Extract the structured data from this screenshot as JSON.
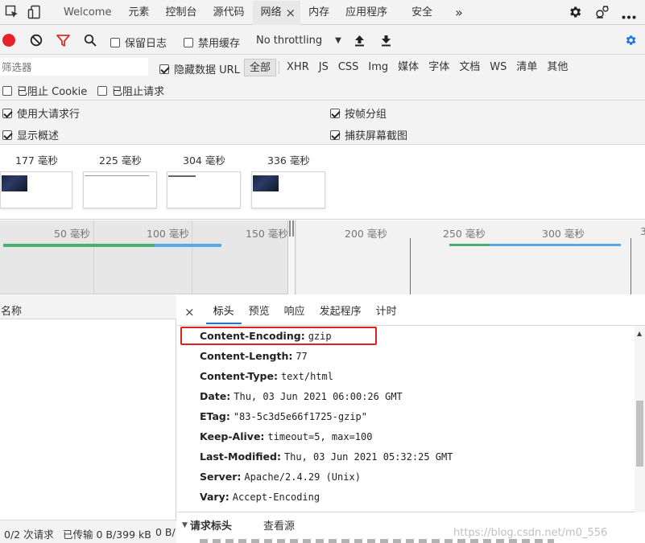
{
  "top_tabs": {
    "items": [
      {
        "label": "Welcome"
      },
      {
        "label": "元素"
      },
      {
        "label": "控制台"
      },
      {
        "label": "源代码"
      },
      {
        "label": "网络",
        "active": true
      },
      {
        "label": "内存"
      },
      {
        "label": "应用程序"
      },
      {
        "label": "安全"
      }
    ],
    "close_glyph": "×",
    "more_glyph": "»"
  },
  "toolbar": {
    "preserve_log": "保留日志",
    "disable_cache": "禁用缓存",
    "throttling": "No throttling"
  },
  "filter_bar": {
    "placeholder": "筛选器",
    "hide_data_urls": "隐藏数据 URL",
    "types": [
      "全部",
      "XHR",
      "JS",
      "CSS",
      "Img",
      "媒体",
      "字体",
      "文档",
      "WS",
      "清单",
      "其他"
    ]
  },
  "block_row": {
    "blocked_cookies": "已阻止 Cookie",
    "blocked_requests": "已阻止请求"
  },
  "options": {
    "large_rows": "使用大请求行",
    "group_by_frame": "按帧分组",
    "show_overview": "显示概述",
    "capture_screenshots": "捕获屏幕截图"
  },
  "screenshots": [
    {
      "time": "177 毫秒"
    },
    {
      "time": "225 毫秒"
    },
    {
      "time": "304 毫秒"
    },
    {
      "time": "336 毫秒"
    }
  ],
  "timeline": {
    "labels": [
      "50 毫秒",
      "100 毫秒",
      "150 毫秒",
      "200 毫秒",
      "250 毫秒",
      "300 毫秒",
      "3"
    ]
  },
  "request_list": {
    "column_name": "名称",
    "status_requests": "0/2 次请求",
    "status_transferred": "已传输 0 B/399 kB",
    "status_more": "0 B/"
  },
  "details": {
    "close_glyph": "×",
    "tabs": [
      "标头",
      "预览",
      "响应",
      "发起程序",
      "计时"
    ],
    "headers": [
      {
        "name": "Content-Encoding:",
        "value": "gzip"
      },
      {
        "name": "Content-Length:",
        "value": "77"
      },
      {
        "name": "Content-Type:",
        "value": "text/html"
      },
      {
        "name": "Date:",
        "value": "Thu, 03 Jun 2021 06:00:26 GMT"
      },
      {
        "name": "ETag:",
        "value": "\"83-5c3d5e66f1725-gzip\""
      },
      {
        "name": "Keep-Alive:",
        "value": "timeout=5, max=100"
      },
      {
        "name": "Last-Modified:",
        "value": "Thu, 03 Jun 2021 05:32:25 GMT"
      },
      {
        "name": "Server:",
        "value": "Apache/2.4.29 (Unix)"
      },
      {
        "name": "Vary:",
        "value": "Accept-Encoding"
      }
    ],
    "request_headers_section": "请求标头",
    "view_source": "查看源"
  },
  "watermark": "https://blog.csdn.net/m0_556",
  "colors": {
    "record_red": "#e8222a",
    "filter_red": "#d93025",
    "accent_blue": "#1a73e8",
    "highlight_box": "#e0201e",
    "tl_green": "#4caf72",
    "tl_blue": "#5aa9e6"
  }
}
